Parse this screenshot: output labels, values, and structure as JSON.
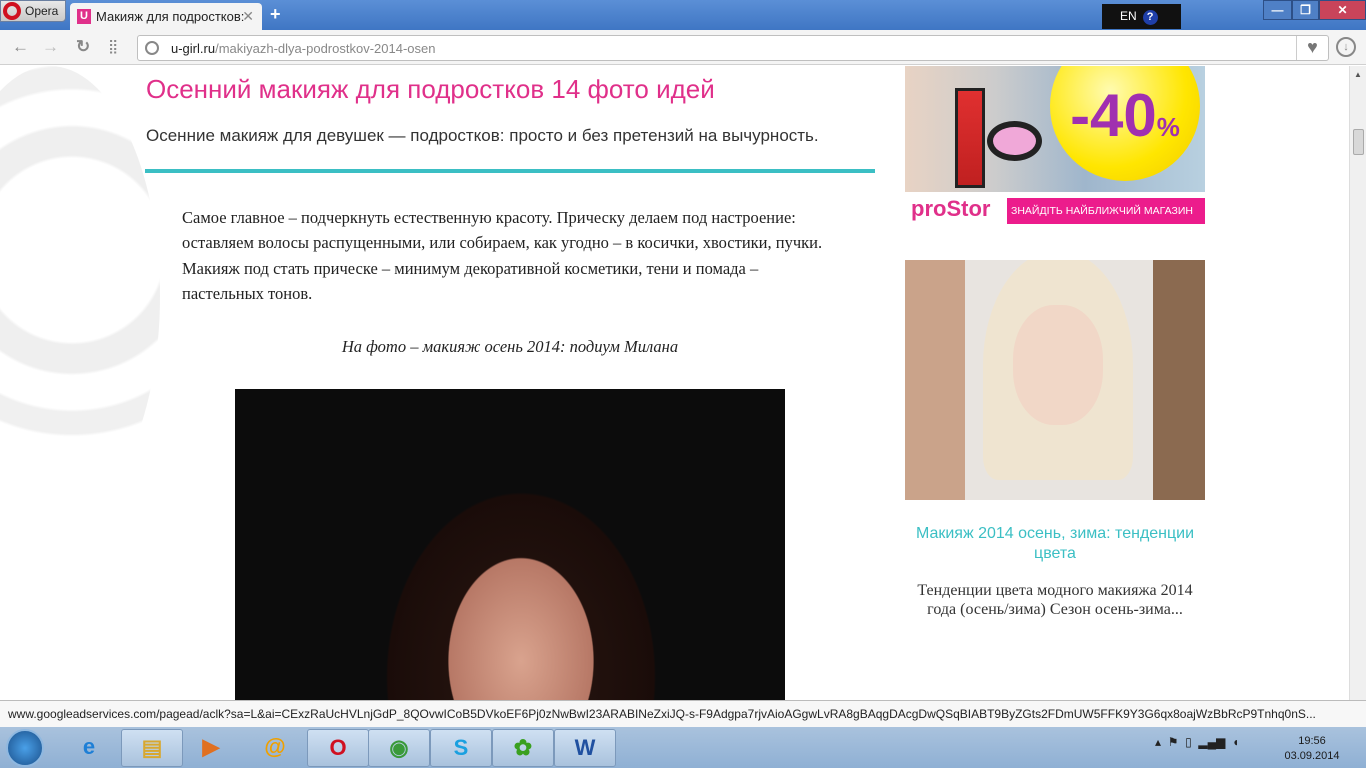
{
  "browser": {
    "menu_label": "Opera",
    "tab_title": "Макияж для подростков:",
    "url_domain": "u-girl.ru",
    "url_path": "/makiyazh-dlya-podrostkov-2014-osen",
    "lang": "EN",
    "help": "?"
  },
  "article": {
    "title": "Осенний макияж для подростков 14 фото идей",
    "subtitle": "Осенние макияж для девушек — подростков: просто и без претензий на вычурность.",
    "paragraph": "Самое главное – подчеркнуть естественную красоту. Прическу делаем под настроение: оставляем волосы распущенными, или собираем, как угодно – в косички, хвостики, пучки. Макияж под стать прическе – минимум декоративной косметики, тени и помада – пастельных тонов.",
    "caption": "На фото – макияж осень 2014: подиум Милана"
  },
  "ad": {
    "discount": "-40",
    "percent": "%",
    "brand": "proStor",
    "cta": "ЗНАЙДІТЬ НАЙБЛИЖЧИЙ МАГАЗИН"
  },
  "sidebar": {
    "link": "Макияж 2014 осень, зима: тенденции цвета",
    "excerpt": "Тенденции цвета модного макияжа 2014 года (осень/зима) Сезон осень-зима..."
  },
  "status_url": "www.googleadservices.com/pagead/aclk?sa=L&ai=CExzRaUcHVLnjGdP_8QOvwICoB5DVkoEF6Pj0zNwBwI23ARABINeZxiJQ-s-F9Adgpa7rjvAioAGgwLvRA8gBAqgDAcgDwQSqBIABT9ByZGts2FDmUW5FFK9Y3G6qx8oajWzBbRcP9Tnhq0nS...",
  "taskbar": {
    "time": "19:56",
    "date": "03.09.2014"
  },
  "colors": {
    "accent_pink": "#e0308a",
    "accent_teal": "#3bbfc4"
  }
}
